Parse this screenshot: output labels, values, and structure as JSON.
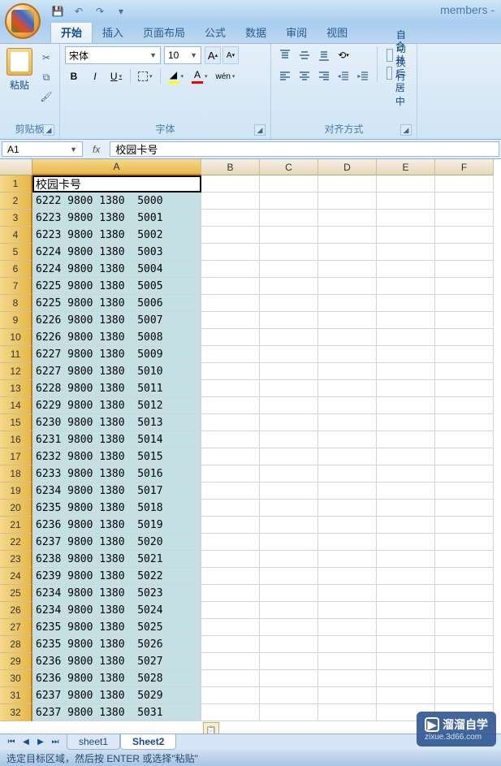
{
  "window": {
    "title": "members -"
  },
  "ribbon": {
    "tabs": [
      "开始",
      "插入",
      "页面布局",
      "公式",
      "数据",
      "审阅",
      "视图"
    ],
    "activeTab": 0,
    "groups": {
      "clipboard": {
        "paste": "粘贴",
        "label": "剪贴板"
      },
      "font": {
        "name": "宋体",
        "size": "10",
        "label": "字体",
        "bold": "B",
        "italic": "I",
        "underline": "U",
        "growA": "A",
        "shrinkA": "A"
      },
      "align": {
        "wrap": "自动换行",
        "merge": "合并后居中",
        "label": "对齐方式"
      }
    }
  },
  "nameBox": "A1",
  "formula": "校园卡号",
  "columns": [
    "A",
    "B",
    "C",
    "D",
    "E",
    "F"
  ],
  "sheetHeader": "校园卡号",
  "cells": [
    "6222 9800 1380  5000",
    "6223 9800 1380  5001",
    "6223 9800 1380  5002",
    "6224 9800 1380  5003",
    "6224 9800 1380  5004",
    "6225 9800 1380  5005",
    "6225 9800 1380  5006",
    "6226 9800 1380  5007",
    "6226 9800 1380  5008",
    "6227 9800 1380  5009",
    "6227 9800 1380  5010",
    "6228 9800 1380  5011",
    "6229 9800 1380  5012",
    "6230 9800 1380  5013",
    "6231 9800 1380  5014",
    "6232 9800 1380  5015",
    "6233 9800 1380  5016",
    "6234 9800 1380  5017",
    "6235 9800 1380  5018",
    "6236 9800 1380  5019",
    "6237 9800 1380  5020",
    "6238 9800 1380  5021",
    "6239 9800 1380  5022",
    "6234 9800 1380  5023",
    "6234 9800 1380  5024",
    "6235 9800 1380  5025",
    "6235 9800 1380  5026",
    "6236 9800 1380  5027",
    "6236 9800 1380  5028",
    "6237 9800 1380  5029",
    "6237 9800 1380  5031"
  ],
  "sheetTabs": [
    "sheet1",
    "Sheet2"
  ],
  "activeSheet": 1,
  "status": "选定目标区域，然后按 ENTER 或选择\"粘贴\"",
  "watermark": {
    "brand": "溜溜自学",
    "url": "zixue.3d66.com"
  }
}
